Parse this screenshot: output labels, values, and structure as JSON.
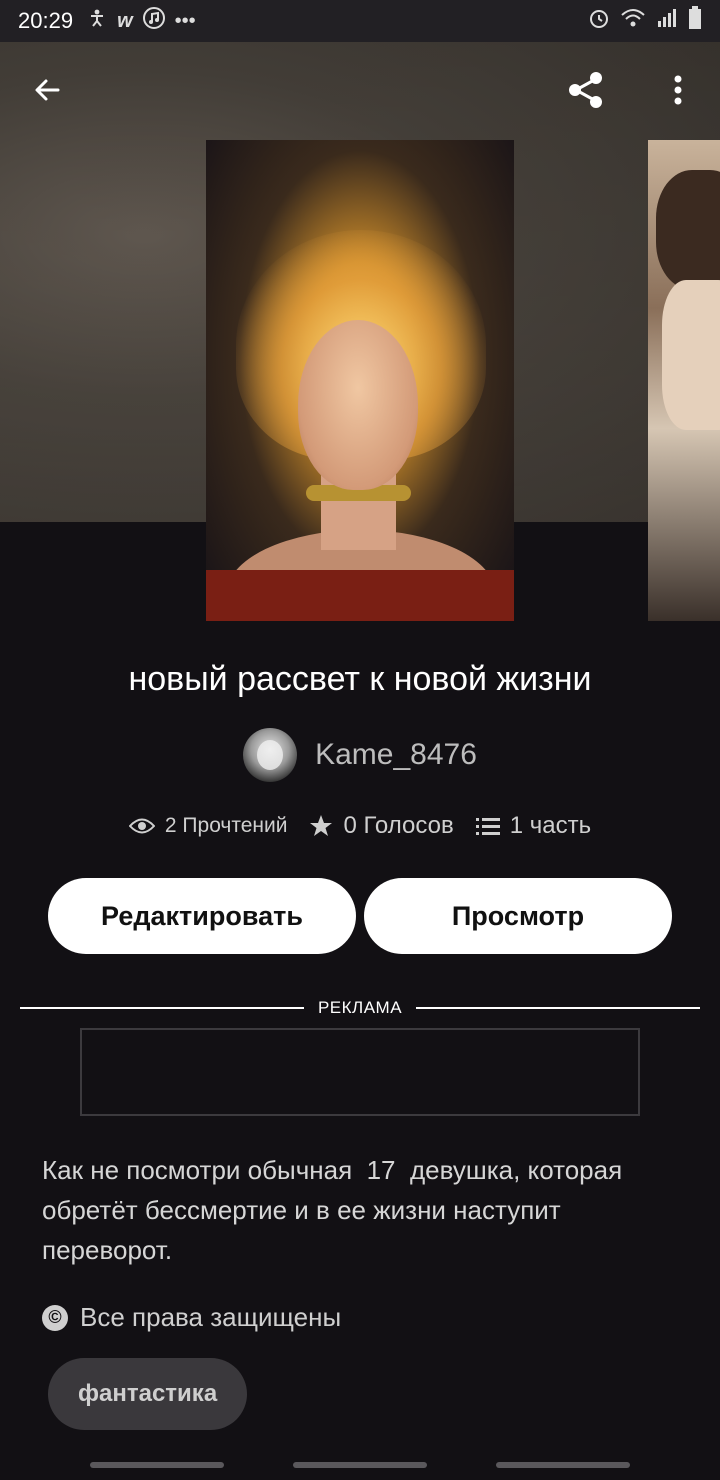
{
  "status_bar": {
    "time": "20:29",
    "left_icons": [
      "accessibility-icon",
      "wattpad-icon",
      "music-icon",
      "more-dots-icon"
    ],
    "right_icons": [
      "alarm-icon",
      "wifi-icon",
      "signal-icon",
      "battery-icon"
    ]
  },
  "header": {
    "back_icon": "arrow-left-icon",
    "share_icon": "share-icon",
    "menu_icon": "kebab-menu-icon"
  },
  "story": {
    "title": "новый рассвет к новой жизни",
    "author": "Kame_8476",
    "reads": "2 Прочтений",
    "votes": "0 Голосов",
    "parts": "1 часть",
    "description": "Как не посмотри обычная  17  девушка, которая обретёт бессмертие и в ее жизни наступит переворот.",
    "rights": "Все права защищены",
    "tag": "фантастика"
  },
  "actions": {
    "edit_label": "Редактировать",
    "preview_label": "Просмотр"
  },
  "ad": {
    "label": "РЕКЛАМА"
  },
  "colors": {
    "background": "#121014",
    "button_bg": "#ffffff",
    "tag_bg": "#3a383c"
  }
}
